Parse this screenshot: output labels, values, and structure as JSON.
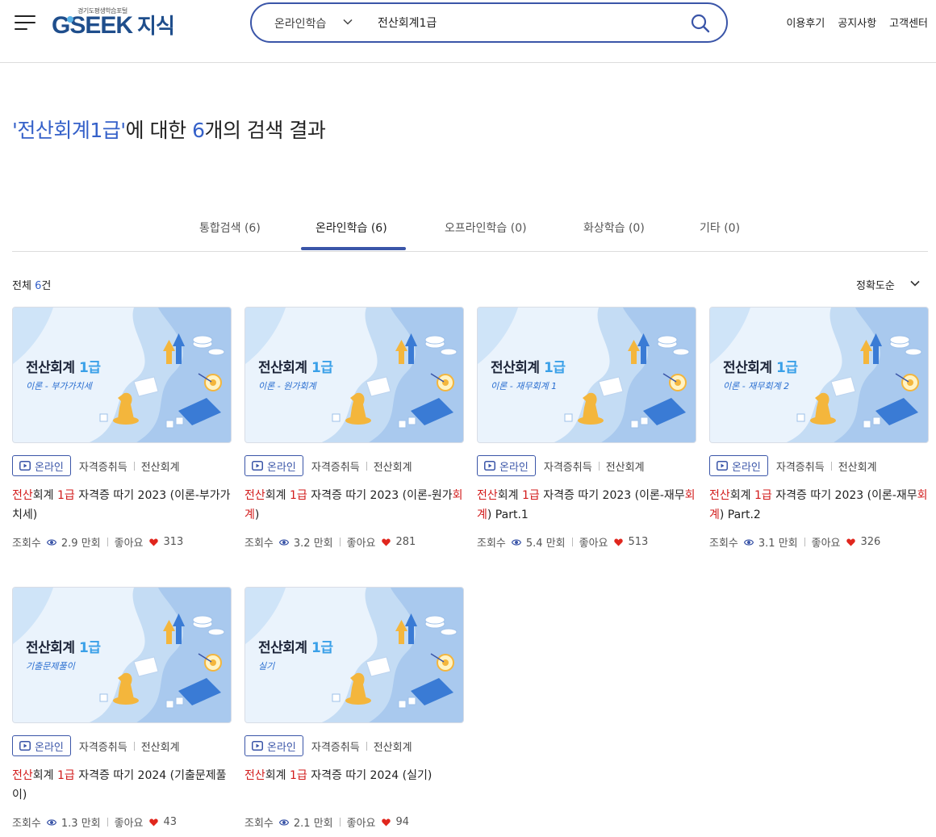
{
  "header": {
    "logo_small": "경기도평생학습포털",
    "logo_g": "G",
    "logo_seek": "SEEK",
    "logo_jisik": "지식",
    "search_category": "온라인학습",
    "search_value": "전산회계1급",
    "nav": [
      "이용후기",
      "공지사항",
      "고객센터"
    ]
  },
  "result": {
    "prefix": "'전산회계1급'",
    "mid": "에 대한 ",
    "count": "6",
    "suffix": "개의 검색 결과"
  },
  "tabs": [
    {
      "label": "통합검색 (6)",
      "active": false
    },
    {
      "label": "온라인학습 (6)",
      "active": true
    },
    {
      "label": "오프라인학습 (0)",
      "active": false
    },
    {
      "label": "화상학습 (0)",
      "active": false
    },
    {
      "label": "기타 (0)",
      "active": false
    }
  ],
  "list": {
    "count_prefix": "전체 ",
    "count_value": "6",
    "count_suffix": "건",
    "sort_label": "정확도순"
  },
  "card_labels": {
    "badge": "온라인",
    "tag1": "자격증취득",
    "tag2": "전산회계",
    "views_label": "조회수",
    "likes_label": "좋아요"
  },
  "colors": {
    "accent": "#3a55a8",
    "highlight": "#d21b1b",
    "blue_text": "#3561c9"
  },
  "courses": [
    {
      "thumb_title": "전산회계",
      "thumb_level": "1급",
      "thumb_sub": "이론 - 부가가치세",
      "title_parts": [
        {
          "t": "전산",
          "hl": true
        },
        {
          "t": "회계 ",
          "hl": false
        },
        {
          "t": "1급",
          "hl": true
        },
        {
          "t": " 자격증 따기 2023 (이론-부가가치세)",
          "hl": false
        }
      ],
      "views": "2.9 만회",
      "likes": "313"
    },
    {
      "thumb_title": "전산회계",
      "thumb_level": "1급",
      "thumb_sub": "이론 - 원가회계",
      "title_parts": [
        {
          "t": "전산",
          "hl": true
        },
        {
          "t": "회계 ",
          "hl": false
        },
        {
          "t": "1급",
          "hl": true
        },
        {
          "t": " 자격증 따기 2023 (이론-원가",
          "hl": false
        },
        {
          "t": "회계",
          "hl": true
        },
        {
          "t": ")",
          "hl": false
        }
      ],
      "views": "3.2 만회",
      "likes": "281"
    },
    {
      "thumb_title": "전산회계",
      "thumb_level": "1급",
      "thumb_sub": "이론 - 재무회계 1",
      "title_parts": [
        {
          "t": "전산",
          "hl": true
        },
        {
          "t": "회계 ",
          "hl": false
        },
        {
          "t": "1급",
          "hl": true
        },
        {
          "t": " 자격증 따기 2023 (이론-재무",
          "hl": false
        },
        {
          "t": "회계",
          "hl": true
        },
        {
          "t": ") Part.1",
          "hl": false
        }
      ],
      "views": "5.4 만회",
      "likes": "513"
    },
    {
      "thumb_title": "전산회계",
      "thumb_level": "1급",
      "thumb_sub": "이론 - 재무회계 2",
      "title_parts": [
        {
          "t": "전산",
          "hl": true
        },
        {
          "t": "회계 ",
          "hl": false
        },
        {
          "t": "1급",
          "hl": true
        },
        {
          "t": " 자격증 따기 2023 (이론-재무",
          "hl": false
        },
        {
          "t": "회계",
          "hl": true
        },
        {
          "t": ") Part.2",
          "hl": false
        }
      ],
      "views": "3.1 만회",
      "likes": "326"
    },
    {
      "thumb_title": "전산회계",
      "thumb_level": "1급",
      "thumb_sub": "기출문제풀이",
      "title_parts": [
        {
          "t": "전산",
          "hl": true
        },
        {
          "t": "회계 ",
          "hl": false
        },
        {
          "t": "1급",
          "hl": true
        },
        {
          "t": " 자격증 따기 2024 (기출문제풀이)",
          "hl": false
        }
      ],
      "views": "1.3 만회",
      "likes": "43"
    },
    {
      "thumb_title": "전산회계",
      "thumb_level": "1급",
      "thumb_sub": "실기",
      "title_parts": [
        {
          "t": "전산",
          "hl": true
        },
        {
          "t": "회계 ",
          "hl": false
        },
        {
          "t": "1급",
          "hl": true
        },
        {
          "t": " 자격증 따기 2024 (실기)",
          "hl": false
        }
      ],
      "views": "2.1 만회",
      "likes": "94"
    }
  ]
}
